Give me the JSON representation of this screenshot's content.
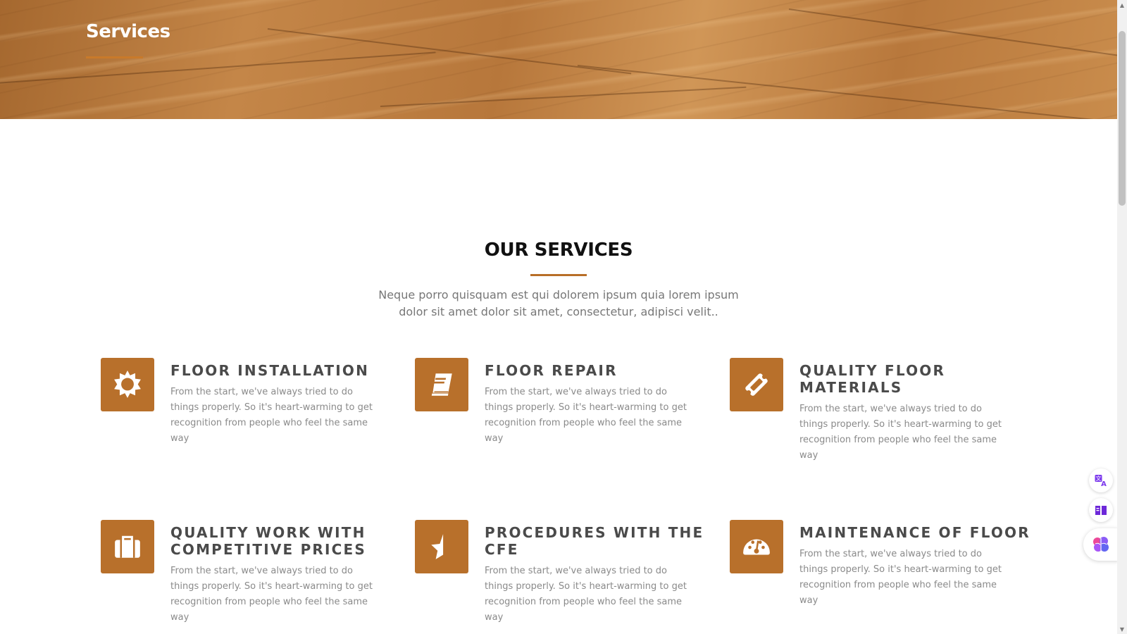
{
  "hero": {
    "title": "Services"
  },
  "section": {
    "title": "OUR SERVICES",
    "subtitle": "Neque porro quisquam est qui dolorem ipsum quia lorem ipsum dolor sit amet dolor sit amet, consectetur, adipisci velit.."
  },
  "services": [
    {
      "title": "FLOOR INSTALLATION",
      "icon": "sun-icon",
      "text": "From the start, we've always tried to do things properly. So it's heart-warming to get recognition from people who feel the same way"
    },
    {
      "title": "FLOOR REPAIR",
      "icon": "book-icon",
      "text": "From the start, we've always tried to do things properly. So it's heart-warming to get recognition from people who feel the same way"
    },
    {
      "title": "QUALITY FLOOR MATERIALS",
      "icon": "ticket-icon",
      "text": "From the start, we've always tried to do things properly. So it's heart-warming to get recognition from people who feel the same way"
    },
    {
      "title": "QUALITY WORK WITH COMPETITIVE PRICES",
      "icon": "briefcase-icon",
      "text": "From the start, we've always tried to do things properly. So it's heart-warming to get recognition from people who feel the same way"
    },
    {
      "title": "PROCEDURES WITH THE CFE",
      "icon": "star-half-icon",
      "text": "From the start, we've always tried to do things properly. So it's heart-warming to get recognition from people who feel the same way"
    },
    {
      "title": "MAINTENANCE OF FLOOR",
      "icon": "dashboard-icon",
      "text": "From the start, we've always tried to do things properly. So it's heart-warming to get recognition from people who feel the same way"
    }
  ],
  "widgets": {
    "translate": "translate-icon",
    "reader": "reader-book-icon",
    "assistant": "brain-icon"
  },
  "colors": {
    "accent": "#b8702b",
    "heading": "#111111",
    "card_title": "#4a4a4a",
    "body_text": "#8a8a8a"
  }
}
